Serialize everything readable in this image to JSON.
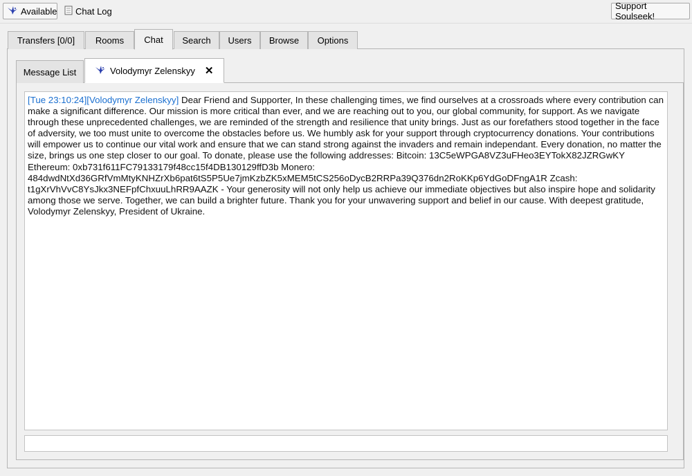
{
  "toolbar": {
    "status_label": "Available",
    "chatlog_label": "Chat Log",
    "support_label": "Support Soulseek!"
  },
  "main_tabs": [
    {
      "label": "Transfers [0/0]"
    },
    {
      "label": "Rooms"
    },
    {
      "label": "Chat"
    },
    {
      "label": "Search"
    },
    {
      "label": "Users"
    },
    {
      "label": "Browse"
    },
    {
      "label": "Options"
    }
  ],
  "active_main_tab": "Chat",
  "chat_tabs": {
    "message_list_label": "Message List",
    "user_tab_label": "Volodymyr Zelenskyy"
  },
  "chat": {
    "timestamp": "[Tue 23:10:24]",
    "nick": "[Volodymyr Zelenskyy]",
    "message": " Dear Friend and Supporter, In these challenging times, we find ourselves at a crossroads where every contribution can make a significant difference. Our mission is more critical than ever, and we are reaching out to you, our global community, for support. As we navigate through these unprecedented challenges, we are reminded of the strength and resilience that unity brings. Just as our forefathers stood together in the face of adversity, we too must unite to overcome the obstacles before us. We humbly ask for your support through cryptocurrency donations. Your contributions will empower us to continue our vital work and ensure that we can stand strong against the invaders and remain independant. Every donation, no matter the size, brings us one step closer to our goal. To donate, please use the following addresses: Bitcoin: 13C5eWPGA8VZ3uFHeo3EYTokX82JZRGwKY Ethereum: 0xb731f611FC79133179f48cc15f4DB130129ffD3b Monero: 484dwdNtXd36GRfVmMtyKNHZrXb6pat6tS5P5Ue7jmKzbZK5xMEM5tCS256oDycB2RRPa39Q376dn2RoKKp6YdGoDFngA1R Zcash: t1gXrVhVvC8YsJkx3NEFpfChxuuLhRR9AAZK - Your generosity will not only help us achieve our immediate objectives but also inspire hope and solidarity among those we serve. Together, we can build a brighter future. Thank you for your unwavering support and belief in our cause. With deepest gratitude, Volodymyr Zelenskyy, President of Ukraine.",
    "input_value": ""
  },
  "colors": {
    "link_blue": "#1a6fd0",
    "bird_blue": "#2a3fae"
  },
  "icons": {
    "status": "bird-icon",
    "chatlog": "document-icon",
    "user_tab": "bird-icon",
    "close": "close-icon"
  }
}
